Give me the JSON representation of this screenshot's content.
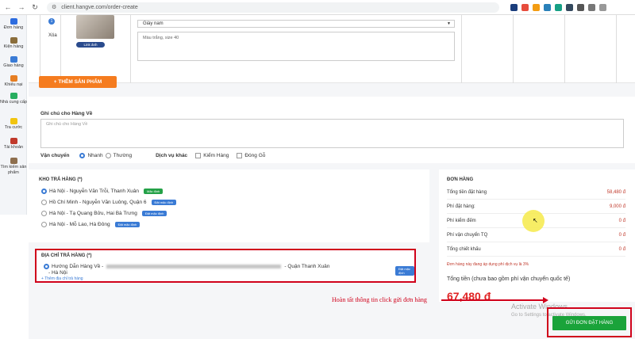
{
  "browser": {
    "url": "client.hangve.com/order-create",
    "back_icon": "arrow-left",
    "forward_icon": "arrow-right",
    "reload_icon": "reload"
  },
  "sidebar": {
    "items": [
      {
        "label": "Đơn hàng",
        "icon": "orders-icon",
        "color": "#2d6cdf"
      },
      {
        "label": "Kiện hàng",
        "icon": "package-icon",
        "color": "#8a6d3b"
      },
      {
        "label": "Giao hàng",
        "icon": "delivery-icon",
        "color": "#3a7bd5"
      },
      {
        "label": "Khiếu nại",
        "icon": "complaint-icon",
        "color": "#e67e22"
      },
      {
        "label": "Nhà cung cấp",
        "icon": "supplier-icon",
        "color": "#27ae60"
      },
      {
        "label": "Tra cước",
        "icon": "fee-icon",
        "color": "#f1c40f"
      },
      {
        "label": "Tài khoản",
        "icon": "account-icon",
        "color": "#c0392b"
      },
      {
        "label": "Tìm kiếm sản phẩm",
        "icon": "search-product-icon",
        "color": "#8e6f4e"
      }
    ]
  },
  "product": {
    "row_number": "1",
    "delete_label": "Xóa",
    "link_image_label": "Link ảnh",
    "select_value": "Giày nam",
    "note_text": "Màu trắng, size 40"
  },
  "add_product_label": "+ THÊM SẢN PHẨM",
  "note": {
    "title": "Ghi chú cho Hàng Về",
    "placeholder": "Ghi chú cho Hàng Về"
  },
  "shipping": {
    "label": "Vận chuyển",
    "options": [
      "Nhanh",
      "Thường"
    ],
    "selected": "Nhanh",
    "services_label": "Dịch vụ khác",
    "services": [
      "Kiểm Hàng",
      "Đóng Gỗ"
    ]
  },
  "warehouse": {
    "title": "KHO TRẢ HÀNG (*)",
    "items": [
      {
        "name": "Hà Nội - Nguyễn Văn Trỗi, Thanh Xuân",
        "tag": "Mặc định",
        "selected": true
      },
      {
        "name": "Hồ Chí Minh - Nguyễn Văn Luông, Quận 6",
        "tag": "Đặt mặc định",
        "selected": false
      },
      {
        "name": "Hà Nội - Tạ Quang Bửu, Hai Bà Trưng",
        "tag": "Đặt mặc định",
        "selected": false
      },
      {
        "name": "Hà Nội - Mỗ Lao, Hà Đông",
        "tag": "Đặt mặc định",
        "selected": false
      }
    ]
  },
  "address": {
    "title": "ĐỊA CHỈ TRẢ HÀNG (*)",
    "line_start": "Hướng Dẫn Hàng Về -",
    "line_end": "- Quận Thanh Xuân",
    "line2": "- Hà Nội",
    "tag": "Đặt mặc định",
    "add_label": "+ Thêm địa chỉ trả hàng"
  },
  "order": {
    "title": "ĐƠN HÀNG",
    "rows": [
      {
        "label": "Tổng tiền đặt hàng",
        "value": "58,480 đ"
      },
      {
        "label": "Phí đặt hàng:",
        "value": "9,000 đ"
      },
      {
        "label": "Phí kiểm đếm",
        "value": "0 đ"
      },
      {
        "label": "Phí vận chuyển TQ",
        "value": "0 đ"
      },
      {
        "label": "Tổng chiết khấu",
        "value": "0 đ"
      }
    ],
    "discount_note": "Đơn hàng này đang áp dụng phí dịch vụ là 3%",
    "total_label": "Tổng tiền (chưa bao gồm phí vận chuyển quốc tế)",
    "total_value": "67,480 đ"
  },
  "callout_text": "Hoàn tất thông tin click gửi đơn hàng",
  "submit_label": "GỬI ĐƠN ĐẶT HÀNG",
  "watermark": {
    "title": "Activate Windows",
    "subtitle": "Go to Settings to activate Windows."
  }
}
